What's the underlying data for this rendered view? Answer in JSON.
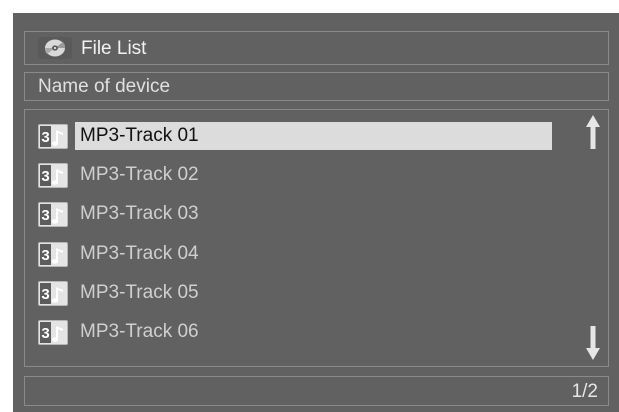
{
  "header": {
    "title": "File List",
    "icon": "disc-icon"
  },
  "device": {
    "label": "Name of device"
  },
  "file_list": {
    "items": [
      {
        "name": "MP3-Track 01",
        "icon": "mp3-track-icon",
        "selected": true
      },
      {
        "name": "MP3-Track 02",
        "icon": "mp3-track-icon",
        "selected": false
      },
      {
        "name": "MP3-Track 03",
        "icon": "mp3-track-icon",
        "selected": false
      },
      {
        "name": "MP3-Track 04",
        "icon": "mp3-track-icon",
        "selected": false
      },
      {
        "name": "MP3-Track 05",
        "icon": "mp3-track-icon",
        "selected": false
      },
      {
        "name": "MP3-Track 06",
        "icon": "mp3-track-icon",
        "selected": false
      }
    ]
  },
  "footer": {
    "page_indicator": "1/2"
  },
  "colors": {
    "background": "#616161",
    "border": "#8a8a8a",
    "selection": "#dcdcdc",
    "text": "#cfcfcf",
    "selected_text": "#111111"
  }
}
